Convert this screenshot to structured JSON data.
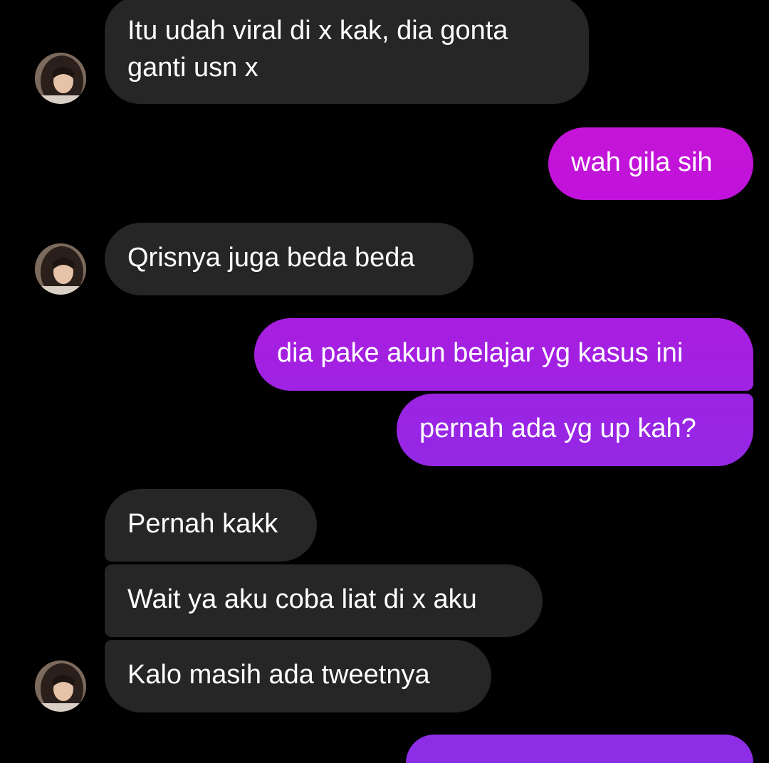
{
  "colors": {
    "background": "#000000",
    "incoming_bubble": "#262626",
    "outgoing_gradient_top": "#c516d9",
    "outgoing_gradient_bottom": "#8b35e8",
    "text": "#ffffff"
  },
  "avatar": {
    "icon": "contact-avatar-photo"
  },
  "messages": [
    {
      "direction": "incoming",
      "text": "Itu udah viral di x kak, dia gonta\nganti usn x"
    },
    {
      "direction": "outgoing",
      "text": "wah gila sih"
    },
    {
      "direction": "incoming",
      "text": "Qrisnya juga beda beda"
    },
    {
      "direction": "outgoing",
      "text": "dia pake akun belajar yg kasus ini"
    },
    {
      "direction": "outgoing",
      "text": "pernah ada yg up kah?"
    },
    {
      "direction": "incoming",
      "text": "Pernah kakk"
    },
    {
      "direction": "incoming",
      "text": "Wait ya aku coba liat di x aku"
    },
    {
      "direction": "incoming",
      "text": "Kalo masih ada tweetnya"
    }
  ]
}
